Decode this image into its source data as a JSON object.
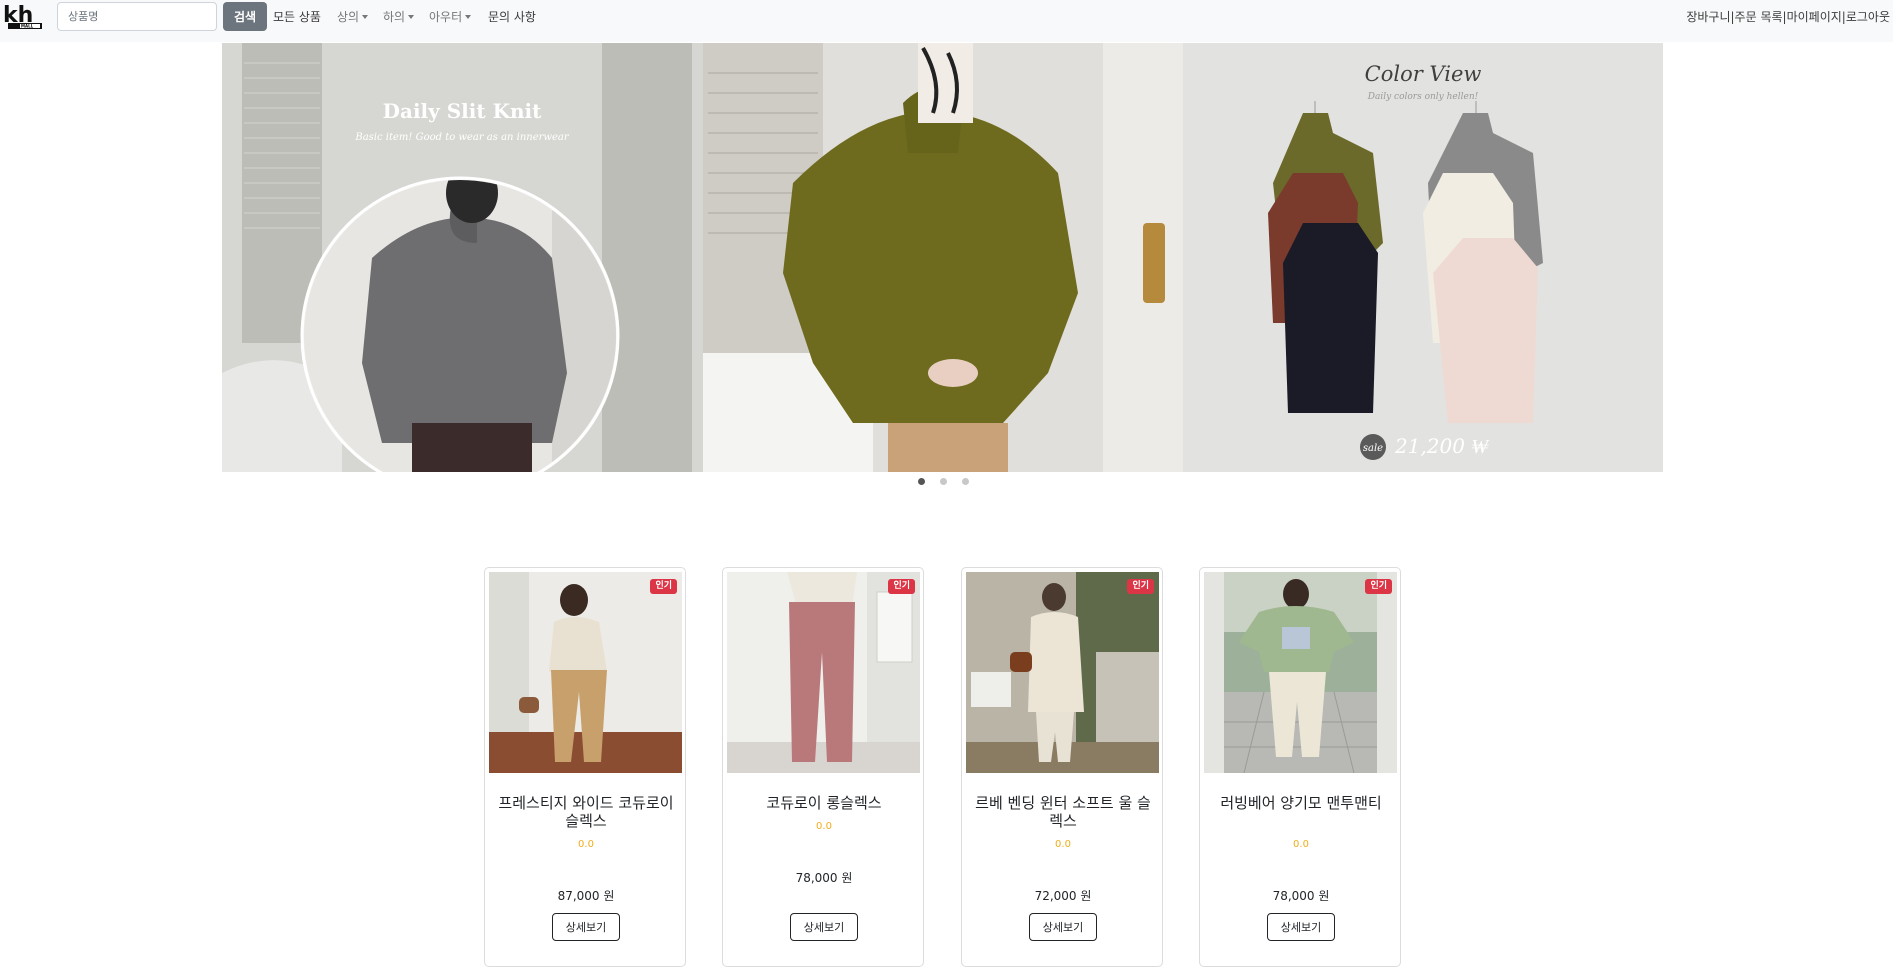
{
  "navbar": {
    "search_placeholder": "상품명",
    "search_button": "검색",
    "all_products": "모든 상품",
    "tops": "상의",
    "bottoms": "하의",
    "outerwear": "아우터",
    "notices": "문의 사항",
    "cart": "장바구니",
    "orders": "주문 목록",
    "mypage": "마이페이지",
    "logout": "로그아웃",
    "separator": "|"
  },
  "carousel": {
    "slide1_title": "Daily Slit Knit",
    "slide1_subtitle": "Basic item! Good to wear as an innerwear",
    "slide3_title": "Color View",
    "slide3_subtitle": "Daily colors only hellen!",
    "slide3_sale_label": "sale",
    "slide3_price": "21,200 ₩",
    "active_index": 0,
    "count": 3
  },
  "products": [
    {
      "badge": "인기",
      "name": "프레스티지 와이드 코듀로이 슬렉스",
      "rating": "0.0",
      "price": "87,000 원",
      "button": "상세보기"
    },
    {
      "badge": "인기",
      "name": "코듀로이 롱슬렉스",
      "rating": "0.0",
      "price": "78,000 원",
      "button": "상세보기"
    },
    {
      "badge": "인기",
      "name": "르베 벤딩 윈터 소프트 울 슬렉스",
      "rating": "0.0",
      "price": "72,000 원",
      "button": "상세보기"
    },
    {
      "badge": "인기",
      "name": "러빙베어 양기모 맨투맨티",
      "rating": "0.0",
      "price": "78,000 원",
      "button": "상세보기"
    }
  ],
  "colors": {
    "navbar_bg": "#f8f9fa",
    "search_button_bg": "#6c757d",
    "badge_red": "#dc3545",
    "rating_orange": "#f0ad1a"
  },
  "icons": {
    "logo": "kh-mall-logo",
    "dropdown": "caret-down-icon"
  }
}
